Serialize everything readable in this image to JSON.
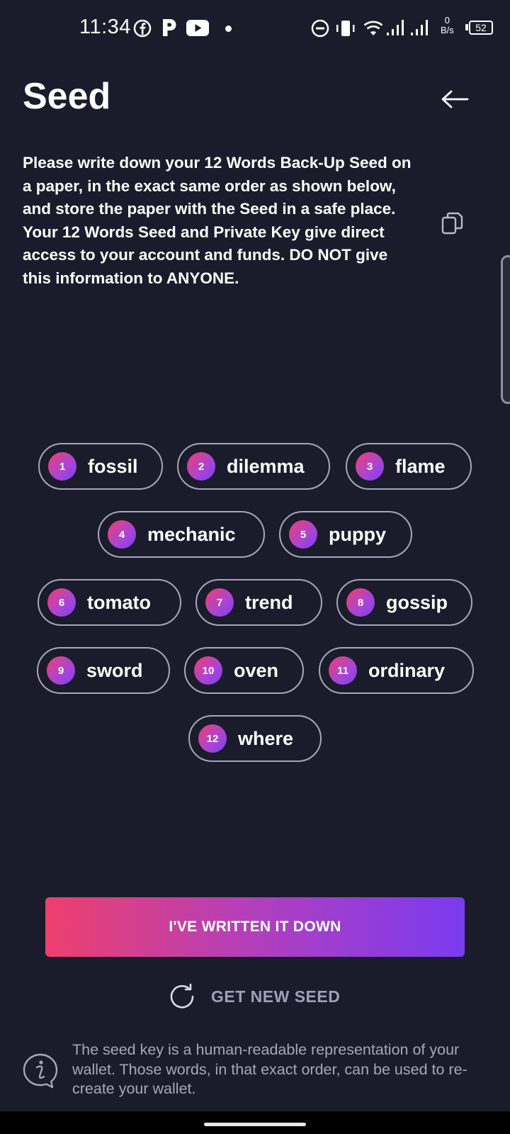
{
  "status_bar": {
    "time": "11:34",
    "net_speed_value": "0",
    "net_speed_unit": "B/s",
    "battery": "52",
    "icons": [
      "facebook-icon",
      "p-app-icon",
      "youtube-icon",
      "notification-dot",
      "dnd-icon",
      "vibrate-icon",
      "wifi-icon",
      "signal-icon",
      "signal-icon-2"
    ]
  },
  "header": {
    "title": "Seed",
    "back_icon": "arrow-left-icon"
  },
  "instructions": "Please write down your 12 Words Back-Up Seed on a paper, in the exact same order as shown below, and store the paper with the Seed in a safe place. Your 12 Words Seed and Private Key give direct access to your account and funds. DO NOT give this information to ANYONE.",
  "copy_icon": "copy-icon",
  "seed_words": [
    {
      "num": "1",
      "word": "fossil"
    },
    {
      "num": "2",
      "word": "dilemma"
    },
    {
      "num": "3",
      "word": "flame"
    },
    {
      "num": "4",
      "word": "mechanic"
    },
    {
      "num": "5",
      "word": "puppy"
    },
    {
      "num": "6",
      "word": "tomato"
    },
    {
      "num": "7",
      "word": "trend"
    },
    {
      "num": "8",
      "word": "gossip"
    },
    {
      "num": "9",
      "word": "sword"
    },
    {
      "num": "10",
      "word": "oven"
    },
    {
      "num": "11",
      "word": "ordinary"
    },
    {
      "num": "12",
      "word": "where"
    }
  ],
  "actions": {
    "confirm_label": "I'VE WRITTEN IT DOWN",
    "new_seed_label": "GET NEW SEED",
    "new_seed_icon": "refresh-icon"
  },
  "info": {
    "icon": "info-icon",
    "text": "The seed key is a human-readable representation of your wallet. Those words, in that exact order, can be used to re-create your wallet."
  },
  "colors": {
    "background": "#1b1c2b",
    "accent_start": "#ee3f6d",
    "accent_end": "#7a3bf0",
    "chip_border": "#a5a6bd",
    "muted_text": "#a5a6ba"
  }
}
